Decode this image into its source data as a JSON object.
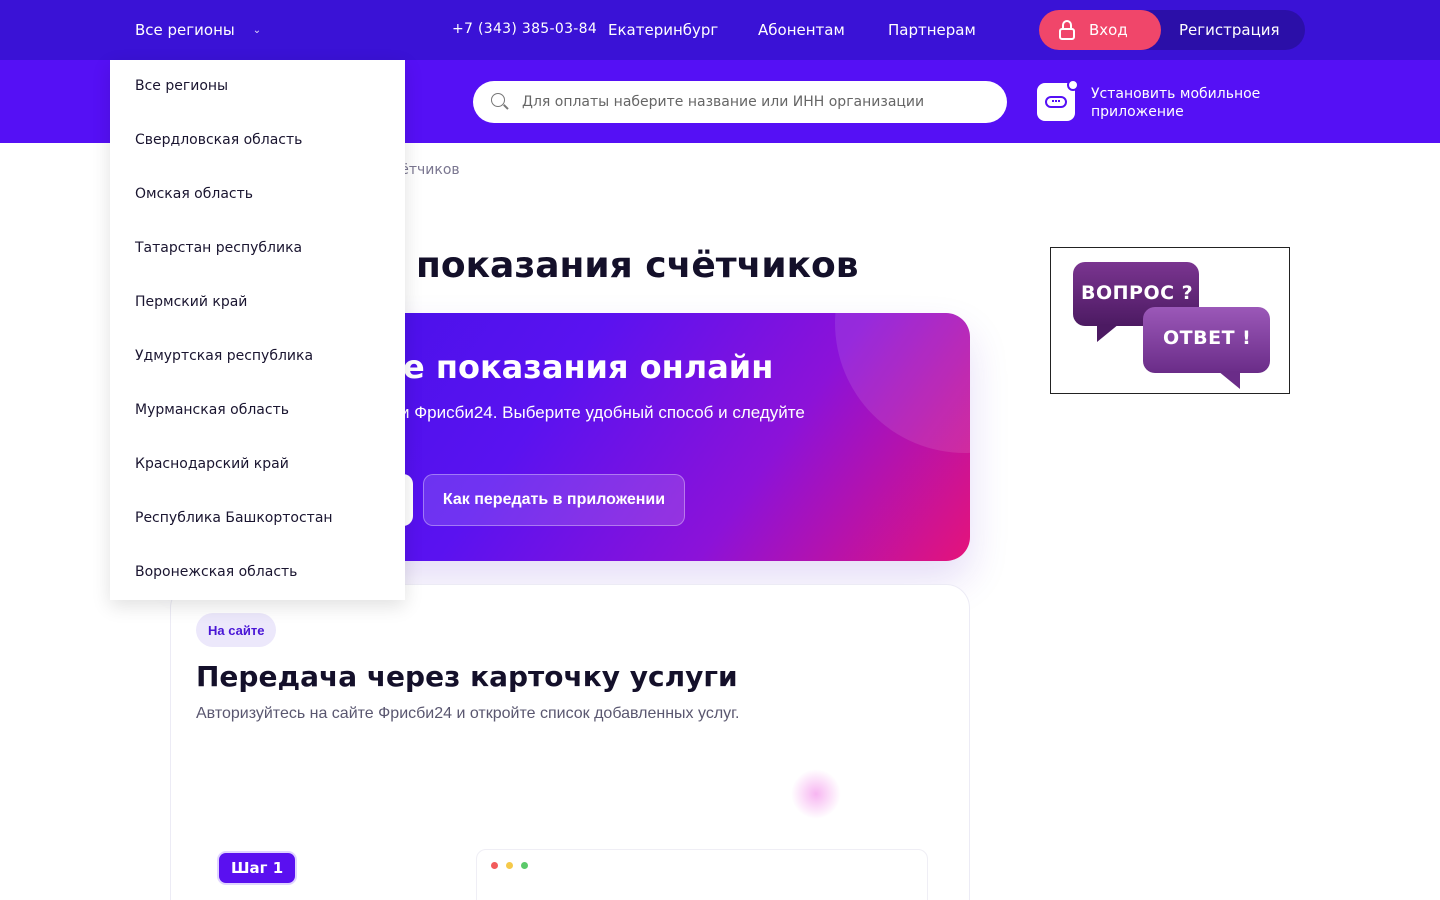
{
  "header": {
    "region_label": "Все регионы",
    "phone": "+7 (343) 385-03-84",
    "city": "Екатеринбург",
    "nav": [
      "Абонентам",
      "Партнерам"
    ],
    "login": "Вход",
    "register": "Регистрация"
  },
  "subheader": {
    "search_placeholder": "Для оплаты наберите название или ИНН организации",
    "app_promo": "Установить мобильное приложение"
  },
  "dropdown": {
    "items": [
      "Все регионы",
      "Свердловская область",
      "Омская область",
      "Татарстан республика",
      "Пермский край",
      "Удмуртская республика",
      "Мурманская область",
      "Краснодарский край",
      "Республика Башкортостан",
      "Воронежская область"
    ]
  },
  "main": {
    "breadcrumb_visible": "чётчиков",
    "title_visible": "показания счётчиков",
    "hero": {
      "title_visible": "е показания онлайн",
      "subtitle_visible": "и Фрисби24. Выберите удобный способ и следуйте",
      "app_button": "Как передать в приложении"
    },
    "card": {
      "badge": "На сайте",
      "title": "Передача через карточку услуги",
      "text": "Авторизуйтесь на сайте Фрисби24 и откройте список добавленных услуг.",
      "step": "Шаг 1"
    }
  },
  "promo": {
    "question": "ВОПРОС ?",
    "answer": "ОТВЕТ !"
  },
  "colors": {
    "topbar": "#3a12d6",
    "subbar": "#5510f5",
    "login": "#f0466a",
    "accent": "#5a10f0"
  }
}
